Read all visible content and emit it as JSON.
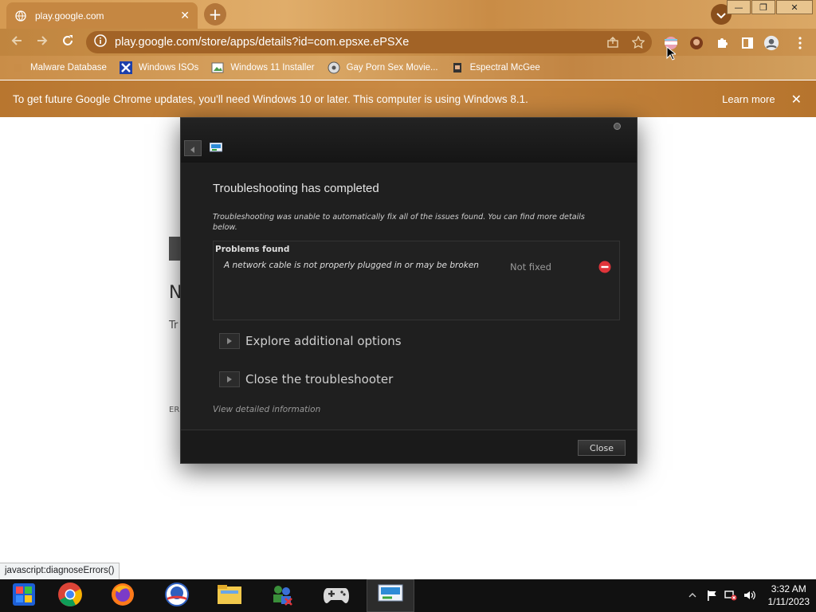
{
  "browser": {
    "tab_title": "play.google.com",
    "url": "play.google.com/store/apps/details?id=com.epsxe.ePSXe",
    "tab_close": "✕",
    "new_tab": "+",
    "win_minimize": "—",
    "win_restore": "❐",
    "win_close": "✕",
    "bookmarks": [
      {
        "label": "Malware Database"
      },
      {
        "label": "Windows ISOs"
      },
      {
        "label": "Windows 11 Installer"
      },
      {
        "label": "Gay Porn Sex Movie..."
      },
      {
        "label": "Espectral McGee"
      }
    ],
    "infobar": {
      "message": "To get future Google Chrome updates, you'll need Windows 10 or later. This computer is using Windows 8.1.",
      "learn_more": "Learn more",
      "close": "✕"
    },
    "status_url": "javascript:diagnoseErrors()"
  },
  "page": {
    "heading": "N",
    "line": "Tr",
    "err": "ER"
  },
  "dialog": {
    "heading": "Troubleshooting has completed",
    "description": "Troubleshooting was unable to automatically fix all of the issues found. You can find more details below.",
    "problems_title": "Problems found",
    "problems": [
      {
        "text": "A network cable is not properly plugged in or may be broken",
        "status": "Not fixed"
      }
    ],
    "option_explore": "Explore additional options",
    "option_close": "Close the troubleshooter",
    "detail_link": "View detailed information",
    "close_button": "Close"
  },
  "taskbar": {
    "time": "3:32 AM",
    "date": "1/11/2023"
  },
  "colors": {
    "chrome_theme": "#c58742",
    "dialog_bg": "#1f1f1f",
    "error_red": "#e0343a"
  }
}
